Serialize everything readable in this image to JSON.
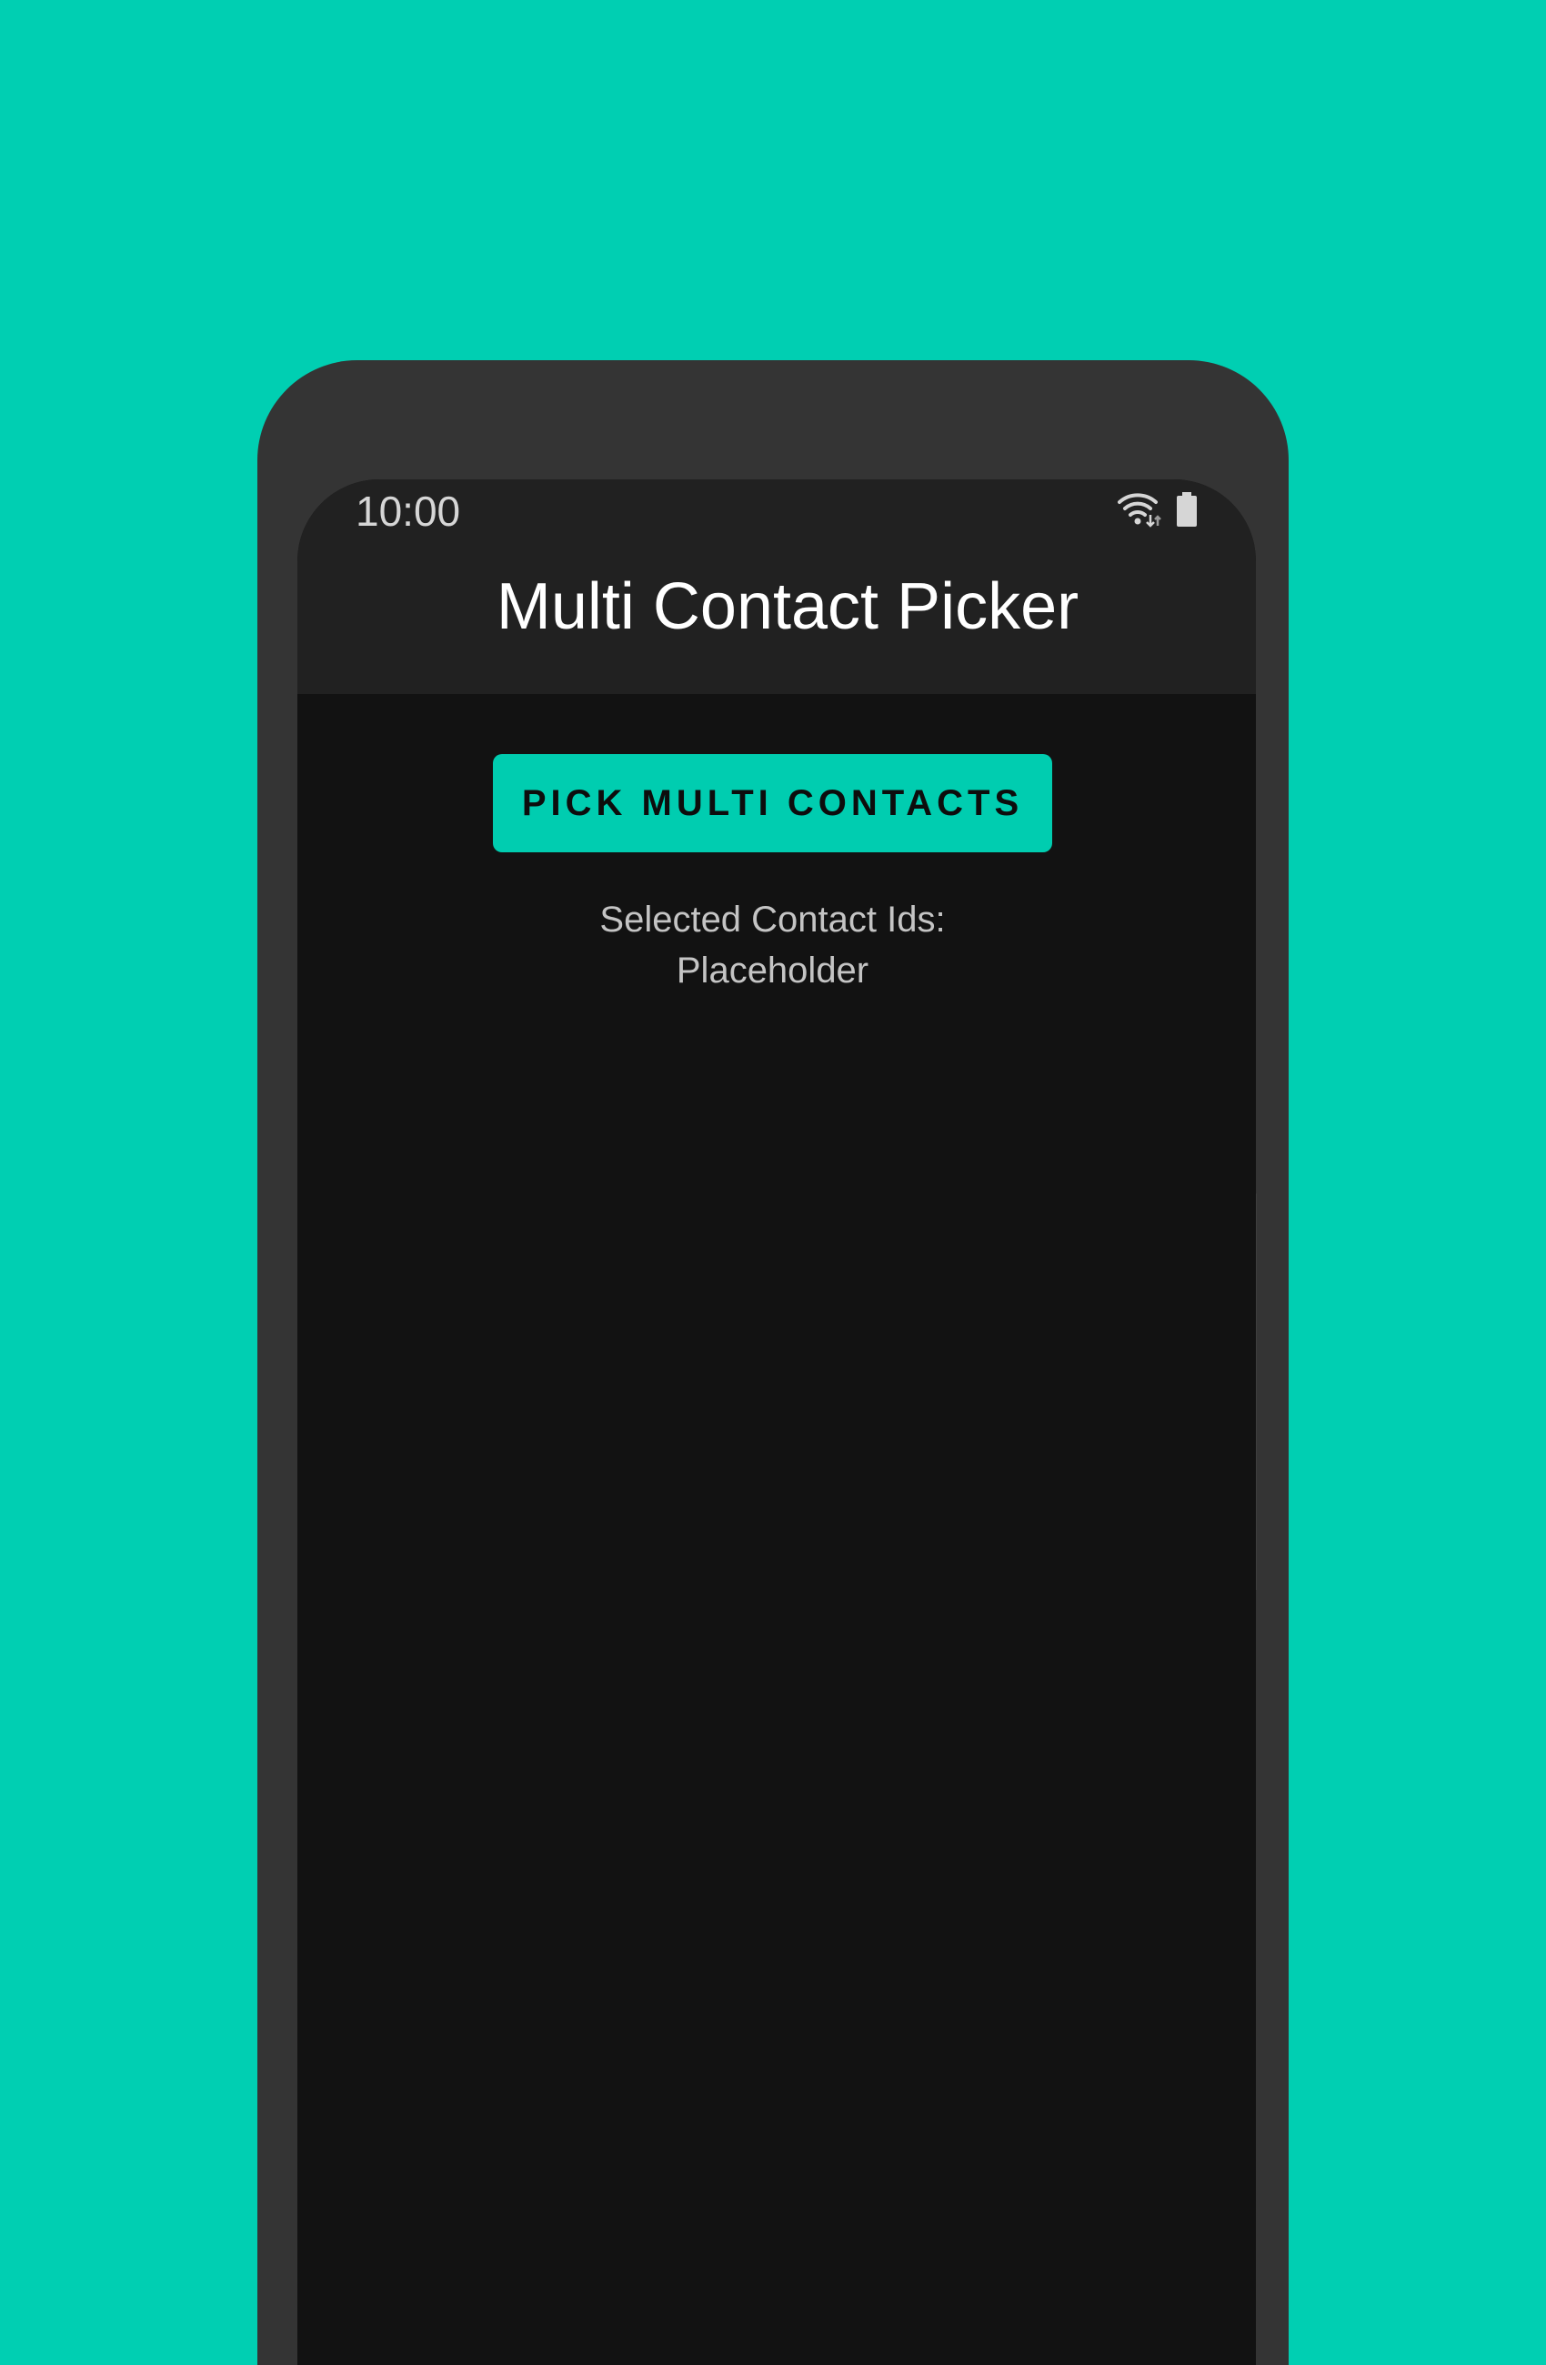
{
  "colors": {
    "background": "#00CFB2",
    "phone_frame": "#343434",
    "app_bar": "#212121",
    "screen": "#121212",
    "accent": "#00CDB0"
  },
  "status_bar": {
    "time": "10:00",
    "icons": [
      "wifi-icon",
      "battery-icon"
    ]
  },
  "app_bar": {
    "title": "Multi Contact Picker"
  },
  "main": {
    "pick_button_label": "PICK MULTI CONTACTS",
    "selected_label": "Selected Contact Ids:",
    "selected_value": "Placeholder"
  }
}
